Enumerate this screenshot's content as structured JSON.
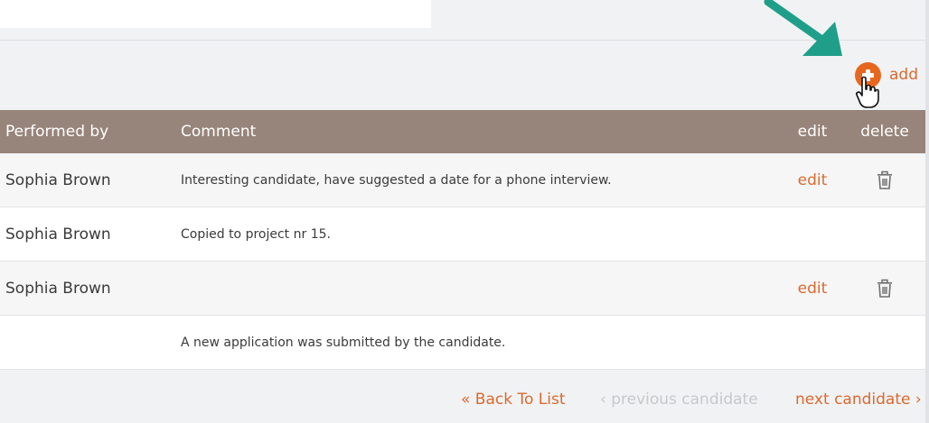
{
  "colors": {
    "accent": "#d96a2e",
    "add_button": "#e8671e",
    "header_bg": "#97847a",
    "arrow": "#1f9f8a"
  },
  "toolbar": {
    "add_label": "add"
  },
  "table": {
    "columns": {
      "performed_by": "Performed by",
      "comment": "Comment",
      "edit": "edit",
      "delete": "delete"
    },
    "rows": [
      {
        "performed_by": "Sophia Brown",
        "comment": "Interesting candidate, have suggested a date for a phone interview.",
        "edit": "edit",
        "deletable": true
      },
      {
        "performed_by": "Sophia Brown",
        "comment": "Copied to project nr 15.",
        "edit": "",
        "deletable": false
      },
      {
        "performed_by": "Sophia Brown",
        "comment": "",
        "edit": "edit",
        "deletable": true
      },
      {
        "performed_by": "",
        "comment": "A new application was submitted by the candidate.",
        "edit": "",
        "deletable": false
      }
    ]
  },
  "nav": {
    "back": "« Back To List",
    "previous": "‹ previous candidate",
    "next": "next candidate ›"
  },
  "icons": {
    "add": "plus-circle-icon",
    "delete": "trash-icon",
    "pointer": "hand-cursor-icon",
    "callout": "arrow-icon"
  }
}
